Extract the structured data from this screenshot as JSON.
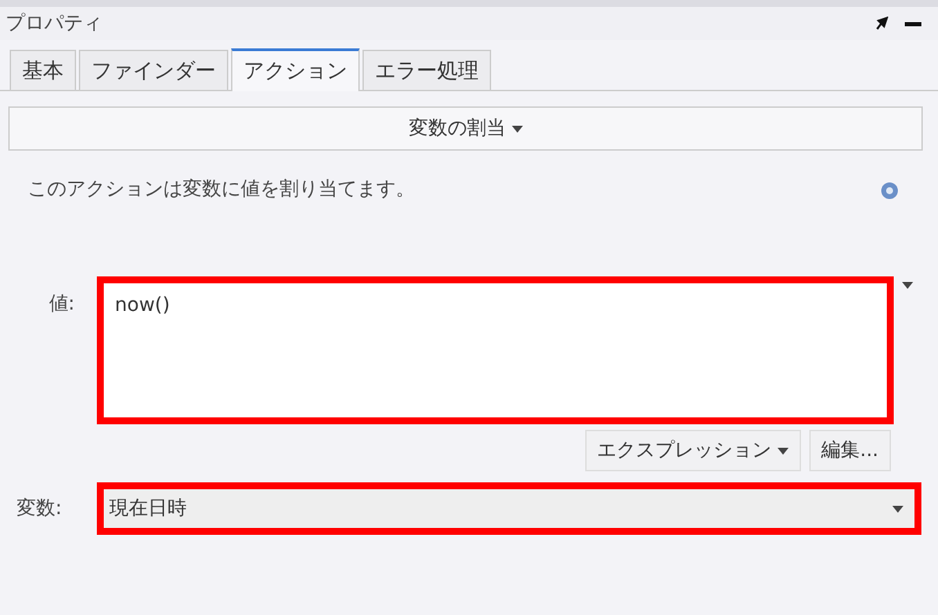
{
  "panel": {
    "title": "プロパティ"
  },
  "tabs": [
    {
      "label": "基本",
      "selected": false
    },
    {
      "label": "ファインダー",
      "selected": false
    },
    {
      "label": "アクション",
      "selected": true
    },
    {
      "label": "エラー処理",
      "selected": false
    }
  ],
  "action_button": {
    "label": "変数の割当"
  },
  "description": "このアクションは変数に値を割り当てます。",
  "value": {
    "label": "値:",
    "text": "now()",
    "highlighted": true
  },
  "buttons": [
    {
      "label": "エクスプレッション",
      "dropdown": true
    },
    {
      "label": "編集...",
      "dropdown": false
    }
  ],
  "variable": {
    "label": "変数:",
    "value": "現在日時",
    "highlighted": true
  }
}
